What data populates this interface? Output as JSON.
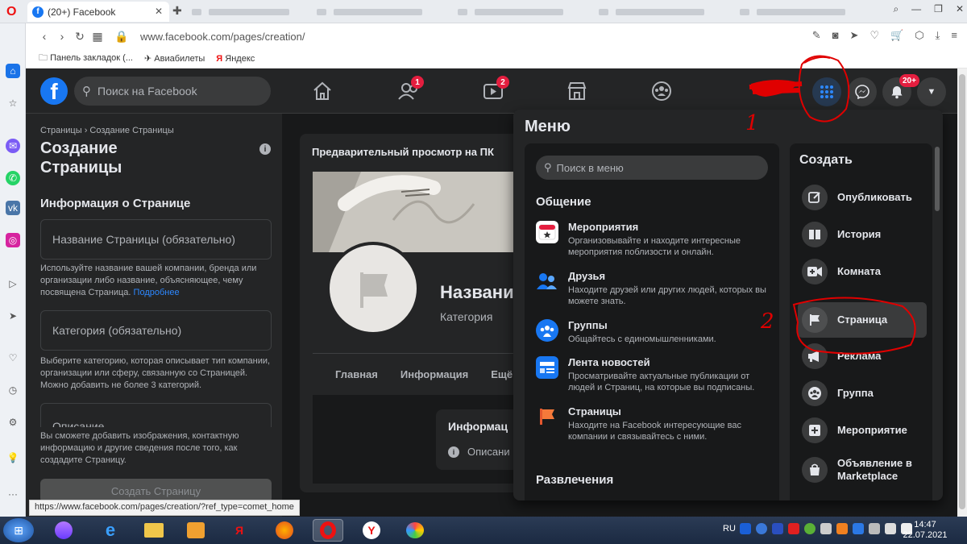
{
  "browser": {
    "tabs": [
      {
        "label": "(20+) Facebook"
      },
      {
        "label": ""
      },
      {
        "label": ""
      },
      {
        "label": ""
      },
      {
        "label": ""
      },
      {
        "label": ""
      }
    ],
    "url": "www.facebook.com/pages/creation/",
    "bookmarks": [
      "Панель закладок (...",
      "Авиабилеты",
      "Яндекс"
    ],
    "status_url": "https://www.facebook.com/pages/creation/?ref_type=comet_home"
  },
  "fb": {
    "search_placeholder": "Поиск на Facebook",
    "friends_badge": "1",
    "watch_badge": "2",
    "notifications_badge": "20+"
  },
  "left": {
    "breadcrumb": "Страницы › Создание Страницы",
    "title": "Создание Страницы",
    "section": "Информация о Странице",
    "name_placeholder": "Название Страницы (обязательно)",
    "name_hint": "Используйте название вашей компании, бренда или организации либо название, объясняющее, чему посвящена Страница.",
    "name_hint_link": "Подробнее",
    "category_placeholder": "Категория (обязательно)",
    "category_hint": "Выберите категорию, которая описывает тип компании, организации или сферу, связанную со Страницей. Можно добавить не более 3 категорий.",
    "desc_placeholder": "Описание",
    "bottom_hint": "Вы сможете добавить изображения, контактную информацию и другие сведения после того, как создадите Страницу.",
    "create_button": "Создать Страницу"
  },
  "preview": {
    "title": "Предварительный просмотр на ПК",
    "name": "Названи",
    "category": "Категория",
    "tabs": [
      "Главная",
      "Информация",
      "Ещё"
    ],
    "info_title": "Информац",
    "info_row": "Описани"
  },
  "menu": {
    "title": "Меню",
    "search_placeholder": "Поиск в меню",
    "social_heading": "Общение",
    "items": [
      {
        "title": "Мероприятия",
        "desc": "Организовывайте и находите интересные мероприятия поблизости и онлайн.",
        "icon": "calendar-icon"
      },
      {
        "title": "Друзья",
        "desc": "Находите друзей или других людей, которых вы можете знать.",
        "icon": "friends-icon"
      },
      {
        "title": "Группы",
        "desc": "Общайтесь с единомышленниками.",
        "icon": "groups-icon"
      },
      {
        "title": "Лента новостей",
        "desc": "Просматривайте актуальные публикации от людей и Страниц, на которые вы подписаны.",
        "icon": "newsfeed-icon"
      },
      {
        "title": "Страницы",
        "desc": "Находите на Facebook интересующие вас компании и связывайтесь с ними.",
        "icon": "pages-flag-icon"
      }
    ],
    "entertainment_heading": "Развлечения",
    "create_heading": "Создать",
    "create_items": [
      {
        "label": "Опубликовать",
        "icon": "compose-icon"
      },
      {
        "label": "История",
        "icon": "book-icon"
      },
      {
        "label": "Комната",
        "icon": "video-plus-icon"
      },
      {
        "label": "Страница",
        "icon": "flag-icon"
      },
      {
        "label": "Реклама",
        "icon": "megaphone-icon"
      },
      {
        "label": "Группа",
        "icon": "group-icon"
      },
      {
        "label": "Мероприятие",
        "icon": "event-plus-icon"
      },
      {
        "label": "Объявление в Marketplace",
        "icon": "shopping-bag-icon"
      }
    ]
  },
  "annotations": {
    "step1": "1",
    "step2": "2"
  },
  "taskbar": {
    "lang": "RU",
    "time": "14:47",
    "date": "22.07.2021"
  },
  "colors": {
    "fb_blue": "#1877f2",
    "badge_red": "#e41e3f",
    "annotation_red": "#e00000"
  }
}
